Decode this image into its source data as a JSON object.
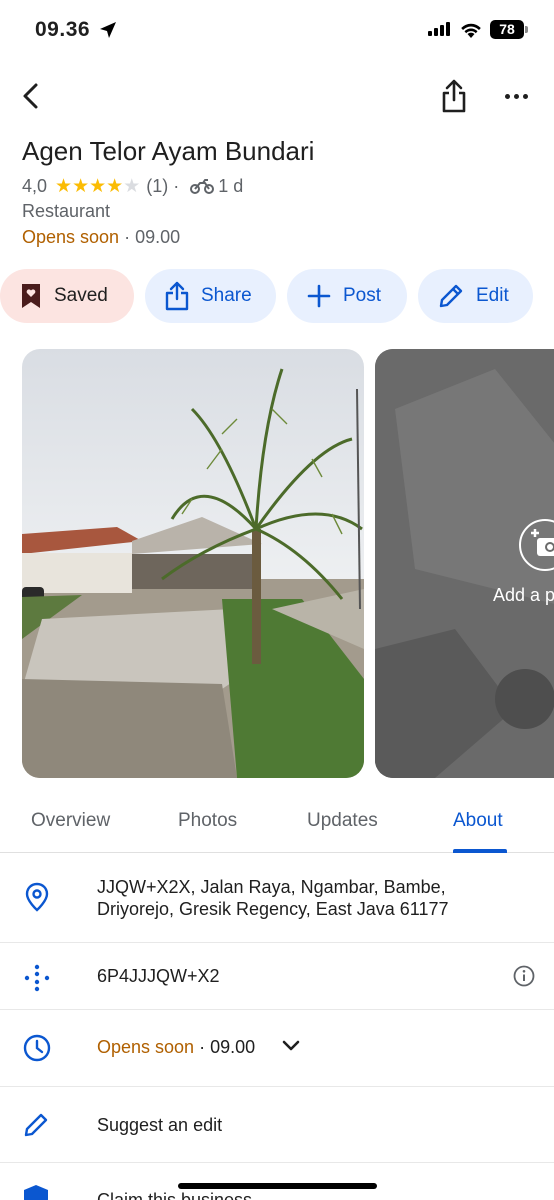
{
  "status_bar": {
    "time": "09.36",
    "battery": "78"
  },
  "place": {
    "title": "Agen Telor Ayam Bundari",
    "rating": "4,0",
    "stars": 4,
    "reviews": "(1)",
    "separator": "·",
    "travel_time": "1 d",
    "category": "Restaurant",
    "status": "Opens soon",
    "hours_sep": " · ",
    "opens_at": "09.00"
  },
  "actions": {
    "saved": "Saved",
    "share": "Share",
    "post": "Post",
    "edit": "Edit"
  },
  "photos": {
    "add_label": "Add a p"
  },
  "tabs": [
    {
      "label": "Overview"
    },
    {
      "label": "Photos"
    },
    {
      "label": "Updates"
    },
    {
      "label": "About",
      "active": true
    }
  ],
  "about": {
    "address": "JJQW+X2X, Jalan Raya, Ngambar, Bambe, Driyorejo, Gresik Regency, East Java 61177",
    "plus_code": "6P4JJJQW+X2",
    "hours_status": "Opens soon",
    "hours_sep": " · ",
    "hours_time": "09.00",
    "suggest_edit": "Suggest an edit",
    "claim": "Claim this business"
  },
  "colors": {
    "accent": "#0b57d0",
    "chip_bg": "#e8f0fe",
    "saved_bg": "#fce4e1",
    "opens_soon": "#b06000",
    "star": "#fbbc04"
  }
}
